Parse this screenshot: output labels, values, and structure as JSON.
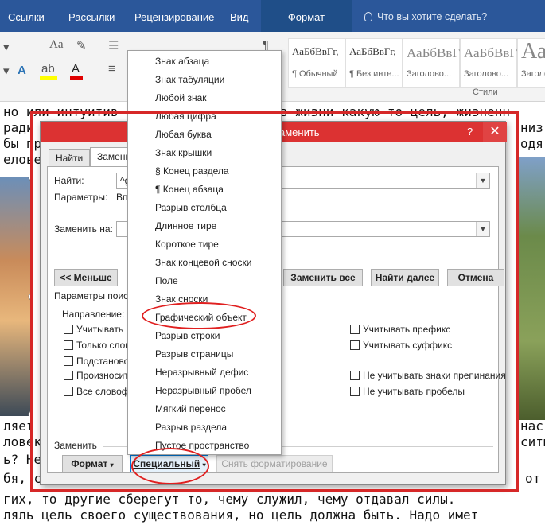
{
  "ribbon_tabs": [
    "Ссылки",
    "Рассылки",
    "Рецензирование",
    "Вид"
  ],
  "active_tab": "Формат",
  "tell_me": "Что вы хотите сделать?",
  "styles": [
    {
      "sample": "АаБбВвГг,",
      "name": "¶ Обычный"
    },
    {
      "sample": "АаБбВвГг,",
      "name": "¶ Без инте..."
    },
    {
      "sample": "АаБбВвГ",
      "name": "Заголово..."
    },
    {
      "sample": "АаБбВвГ",
      "name": "Заголово..."
    },
    {
      "sample": "Аа",
      "name": "Заголово..."
    }
  ],
  "styles_group_label": "Стили",
  "document_lines": {
    "l1_a": "но или интуитив",
    "l1_b": "в жизни какую-то цель, жизненн",
    "l2_a": "ради",
    "l2_b": "низ",
    "l3_a": "бы пр",
    "l3_b": "одя",
    "l4_a": "елове",
    "l5_a": "ляет",
    "l5_b": "нас",
    "l6_a": "ловек",
    "l6_b": "ситы",
    "l7_a": "ь? Не",
    "l8_a": "бя, с",
    "l8_b": "от",
    "l9": "гих, то другие сберегут то, чему служил, чему отдавал силы.",
    "l10": "ляль цель своего существования, но цель должна быть. Надо имет"
  },
  "dialog": {
    "title": "аменить",
    "help": "?",
    "close": "✕",
    "tabs": [
      "Найти",
      "Замени"
    ],
    "find_label": "Найти:",
    "find_value": "^g",
    "params_label": "Параметры:",
    "params_value": "Вп",
    "replace_label": "Заменить на:",
    "less_button": "<< Меньше",
    "replace_all_button": "Заменить все",
    "find_next_button": "Найти далее",
    "cancel_button": "Отмена",
    "search_params_label": "Параметры поиск",
    "direction_label": "Направление:",
    "left_checkboxes": [
      "Учитывать р",
      "Только слово",
      "Подстановоч",
      "Произносит",
      "Все словофо"
    ],
    "right_checkboxes": [
      "Учитывать префикс",
      "Учитывать суффикс",
      "Не учитывать знаки препинания",
      "Не учитывать пробелы"
    ],
    "replace_section_label": "Заменить",
    "format_button": "Формат",
    "special_button": "Специальный",
    "clear_format_button": "Снять форматирование"
  },
  "special_menu": [
    "Знак абзаца",
    "Знак табуляции",
    "Любой знак",
    "Любая цифра",
    "Любая буква",
    "Знак крышки",
    "§ Конец раздела",
    "¶ Конец абзаца",
    "Разрыв столбца",
    "Длинное тире",
    "Короткое тире",
    "Знак концевой сноски",
    "Поле",
    "Знак сноски",
    "Графический объект",
    "Разрыв строки",
    "Разрыв страницы",
    "Неразрывный дефис",
    "Неразрывный пробел",
    "Мягкий перенос",
    "Разрыв раздела",
    "Пустое пространство"
  ],
  "colors": {
    "ribbon_blue": "#2b579a",
    "dialog_title_red": "#dc3232",
    "annotation_red": "#e02020"
  }
}
